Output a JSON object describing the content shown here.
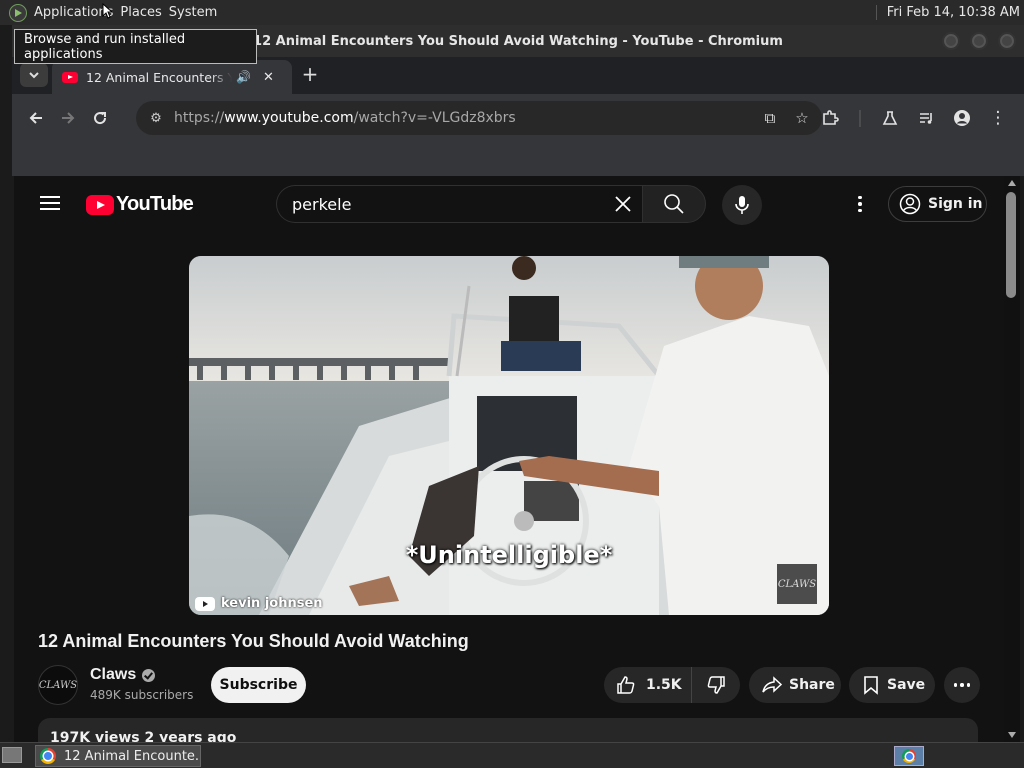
{
  "top_panel": {
    "menus": [
      "Applications",
      "Places",
      "System"
    ],
    "clock": "Fri Feb 14, 10:38 AM"
  },
  "tooltip": "Browse and run installed applications",
  "window": {
    "title": "12 Animal Encounters You Should Avoid Watching - YouTube - Chromium"
  },
  "tabs": [
    {
      "title": "12 Animal Encounters You Should Avoid Watching",
      "audio": true
    }
  ],
  "toolbar": {
    "url_prefix": "https://",
    "url_host": "www.youtube.com",
    "url_path": "/watch?v=-VLGdz8xbrs"
  },
  "youtube": {
    "logo_text": "YouTube",
    "search_value": "perkele",
    "sign_in": "Sign in",
    "video": {
      "caption": "*Unintelligible*",
      "watermark": "kevin johnsen",
      "corner_mark": "CLAWS",
      "title": "12 Animal Encounters You Should Avoid Watching"
    },
    "channel": {
      "avatar_text": "CLAWS",
      "name": "Claws",
      "subscribers": "489K subscribers",
      "subscribe_label": "Subscribe"
    },
    "actions": {
      "likes": "1.5K",
      "share": "Share",
      "save": "Save"
    },
    "description_preview": "197K views  2 years ago"
  },
  "taskbar": {
    "task_title": "12 Animal Encounte..."
  }
}
